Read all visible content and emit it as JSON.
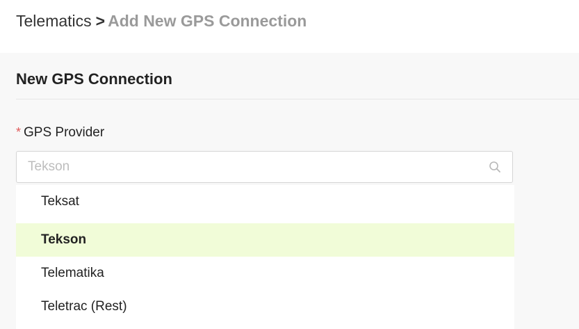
{
  "breadcrumb": {
    "root": "Telematics",
    "separator": ">",
    "current": "Add New GPS Connection"
  },
  "section": {
    "title": "New GPS Connection"
  },
  "gps_provider": {
    "required_mark": "*",
    "label": "GPS Provider",
    "placeholder": "Tekson",
    "search_icon": "search-icon",
    "options": [
      {
        "label": "Teksat",
        "selected": false
      },
      {
        "label": "Tekson",
        "selected": true
      },
      {
        "label": "Telematika",
        "selected": false
      },
      {
        "label": "Teletrac (Rest)",
        "selected": false
      }
    ]
  },
  "colors": {
    "selected_option_bg": "#f1fcd8",
    "required_mark": "#e05a5a",
    "breadcrumb_current": "#9a9a9a",
    "content_bg": "#f8f8f8"
  }
}
